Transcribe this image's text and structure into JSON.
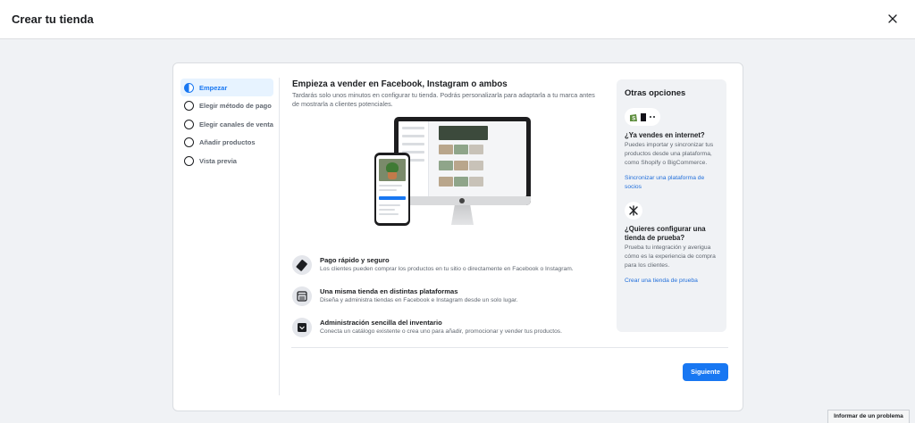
{
  "header": {
    "title": "Crear tu tienda",
    "close_icon": "close-icon"
  },
  "steps": [
    {
      "label": "Empezar",
      "active": true
    },
    {
      "label": "Elegir método de pago",
      "active": false
    },
    {
      "label": "Elegir canales de venta",
      "active": false
    },
    {
      "label": "Añadir productos",
      "active": false
    },
    {
      "label": "Vista previa",
      "active": false
    }
  ],
  "main": {
    "title": "Empieza a vender en Facebook, Instagram o ambos",
    "lead": "Tardarás solo unos minutos en configurar tu tienda. Podrás personalizarla para adaptarla a tu marca antes de mostrarla a clientes potenciales.",
    "features": [
      {
        "icon": "card-icon",
        "title": "Pago rápido y seguro",
        "desc": "Los clientes pueden comprar los productos en tu sitio o directamente en Facebook o Instagram."
      },
      {
        "icon": "storefront-icon",
        "title": "Una misma tienda en distintas plataformas",
        "desc": "Diseña y administra tiendas en Facebook e Instagram desde un solo lugar."
      },
      {
        "icon": "catalog-icon",
        "title": "Administración sencilla del inventario",
        "desc": "Conecta un catálogo existente o crea uno para añadir, promocionar y vender tus productos."
      }
    ],
    "next_label": "Siguiente"
  },
  "other": {
    "title": "Otras opciones",
    "q1": "¿Ya vendes en internet?",
    "p1": "Puedes importar y sincronizar tus productos desde una plataforma, como Shopify o BigCommerce.",
    "link1": "Sincronizar una plataforma de socios",
    "q2": "¿Quieres configurar una tienda de prueba?",
    "p2": "Prueba tu integración y averigua cómo es la experiencia de compra para los clientes.",
    "link2": "Crear una tienda de prueba"
  },
  "footer": {
    "report_label": "Informar de un problema"
  },
  "colors": {
    "accent": "#1877f2",
    "link": "#216fdb",
    "background": "#f0f2f5"
  }
}
